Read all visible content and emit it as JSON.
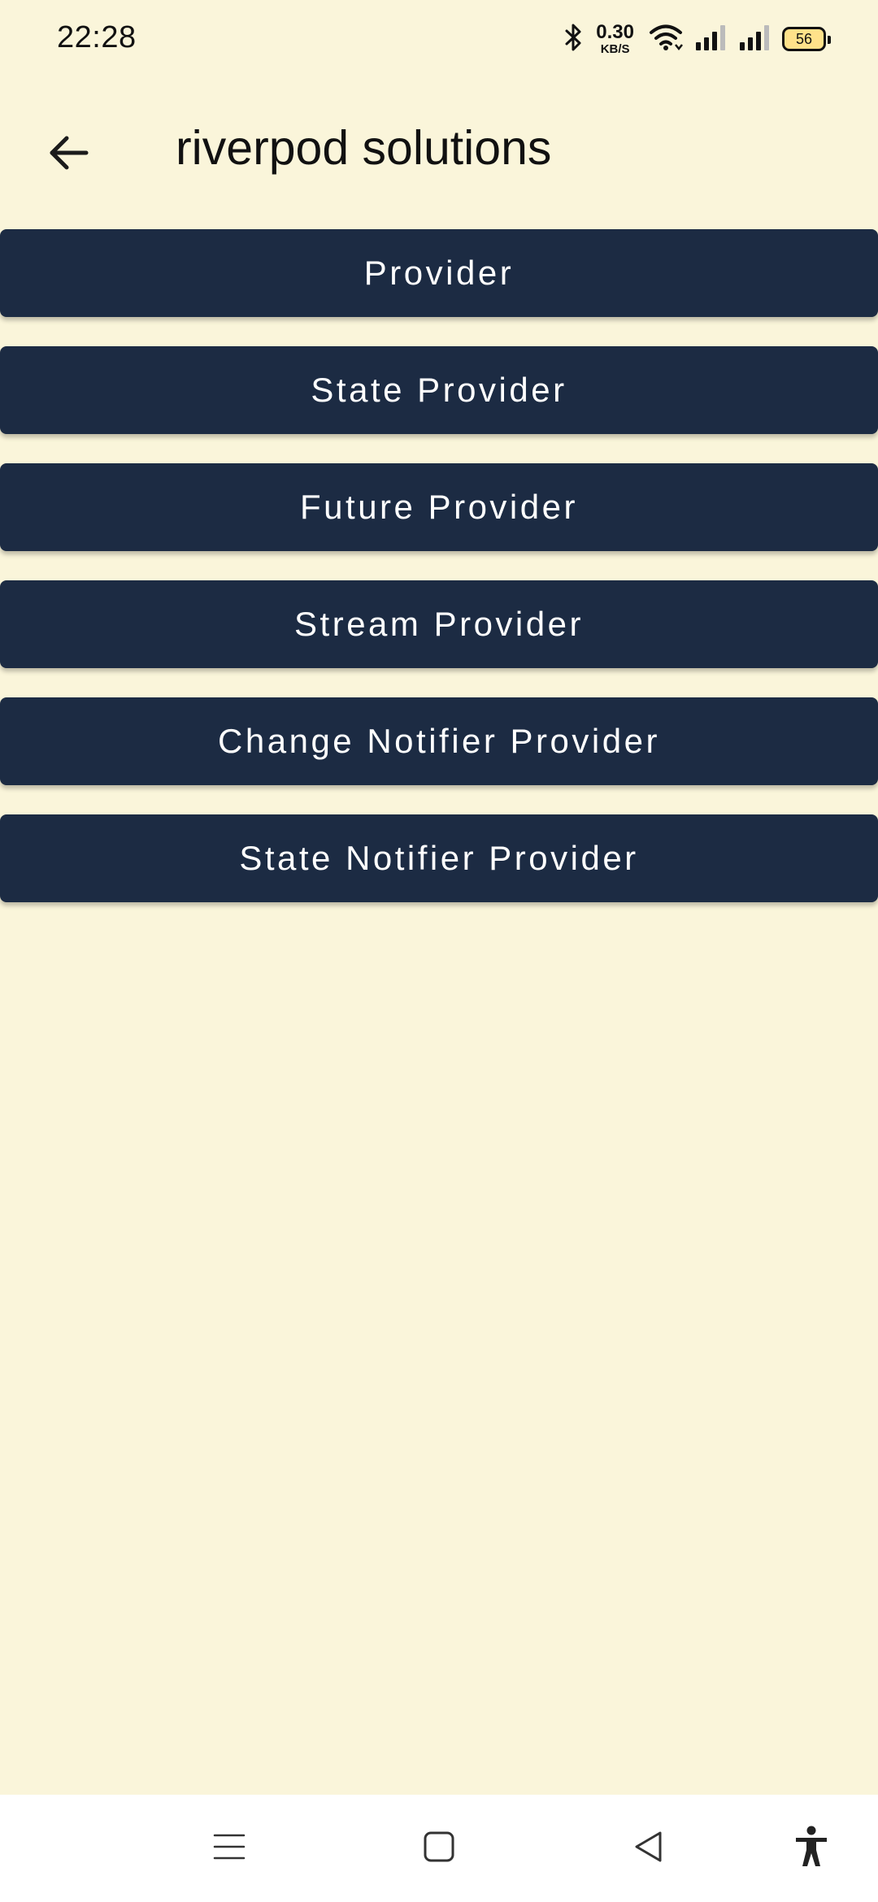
{
  "status_bar": {
    "time": "22:28",
    "net_speed_value": "0.30",
    "net_speed_unit": "KB/S",
    "battery_level": "56",
    "icons": [
      "bluetooth-icon",
      "wifi-icon",
      "signal-icon",
      "signal-icon",
      "battery-icon"
    ]
  },
  "app_bar": {
    "back_icon": "arrow-left-icon",
    "title": "riverpod solutions"
  },
  "buttons": [
    {
      "label": "Provider"
    },
    {
      "label": "State Provider"
    },
    {
      "label": "Future Provider"
    },
    {
      "label": "Stream Provider"
    },
    {
      "label": "Change Notifier Provider"
    },
    {
      "label": "State Notifier Provider"
    }
  ],
  "nav_bar": {
    "items": [
      "menu-icon",
      "home-icon",
      "back-icon",
      "accessibility-icon"
    ]
  },
  "colors": {
    "background": "#FAF5DA",
    "button": "#1C2B43",
    "button_text": "#FFFFFF",
    "nav_bar": "#FFFFFF"
  }
}
